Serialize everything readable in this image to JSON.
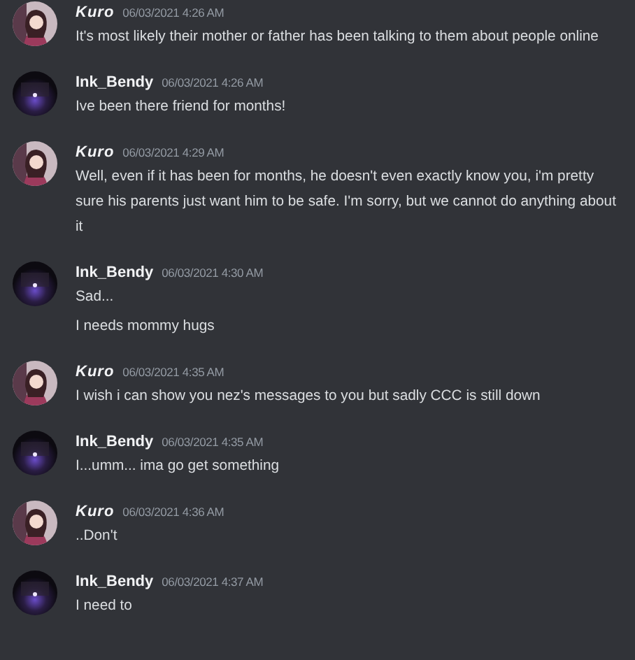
{
  "messages": [
    {
      "author": "Kuro",
      "kind": "kuro",
      "timestamp": "06/03/2021 4:26 AM",
      "lines": [
        "It's most likely their mother or father has been talking to them about people online"
      ]
    },
    {
      "author": "Ink_Bendy",
      "kind": "bendy",
      "timestamp": "06/03/2021 4:26 AM",
      "lines": [
        "Ive been there friend for months!"
      ]
    },
    {
      "author": "Kuro",
      "kind": "kuro",
      "timestamp": "06/03/2021 4:29 AM",
      "lines": [
        "Well, even if it has been for months, he doesn't even exactly know you, i'm pretty sure his parents just want him to be safe. I'm sorry, but we cannot do anything about it"
      ]
    },
    {
      "author": "Ink_Bendy",
      "kind": "bendy",
      "timestamp": "06/03/2021 4:30 AM",
      "lines": [
        "Sad...",
        "I needs mommy hugs"
      ]
    },
    {
      "author": "Kuro",
      "kind": "kuro",
      "timestamp": "06/03/2021 4:35 AM",
      "lines": [
        "I wish i can show you nez's messages to you but sadly CCC is still down"
      ]
    },
    {
      "author": "Ink_Bendy",
      "kind": "bendy",
      "timestamp": "06/03/2021 4:35 AM",
      "lines": [
        "I...umm... ima go get something"
      ]
    },
    {
      "author": "Kuro",
      "kind": "kuro",
      "timestamp": "06/03/2021 4:36 AM",
      "lines": [
        "..Don't"
      ]
    },
    {
      "author": "Ink_Bendy",
      "kind": "bendy",
      "timestamp": "06/03/2021 4:37 AM",
      "lines": [
        "I need to"
      ]
    }
  ]
}
